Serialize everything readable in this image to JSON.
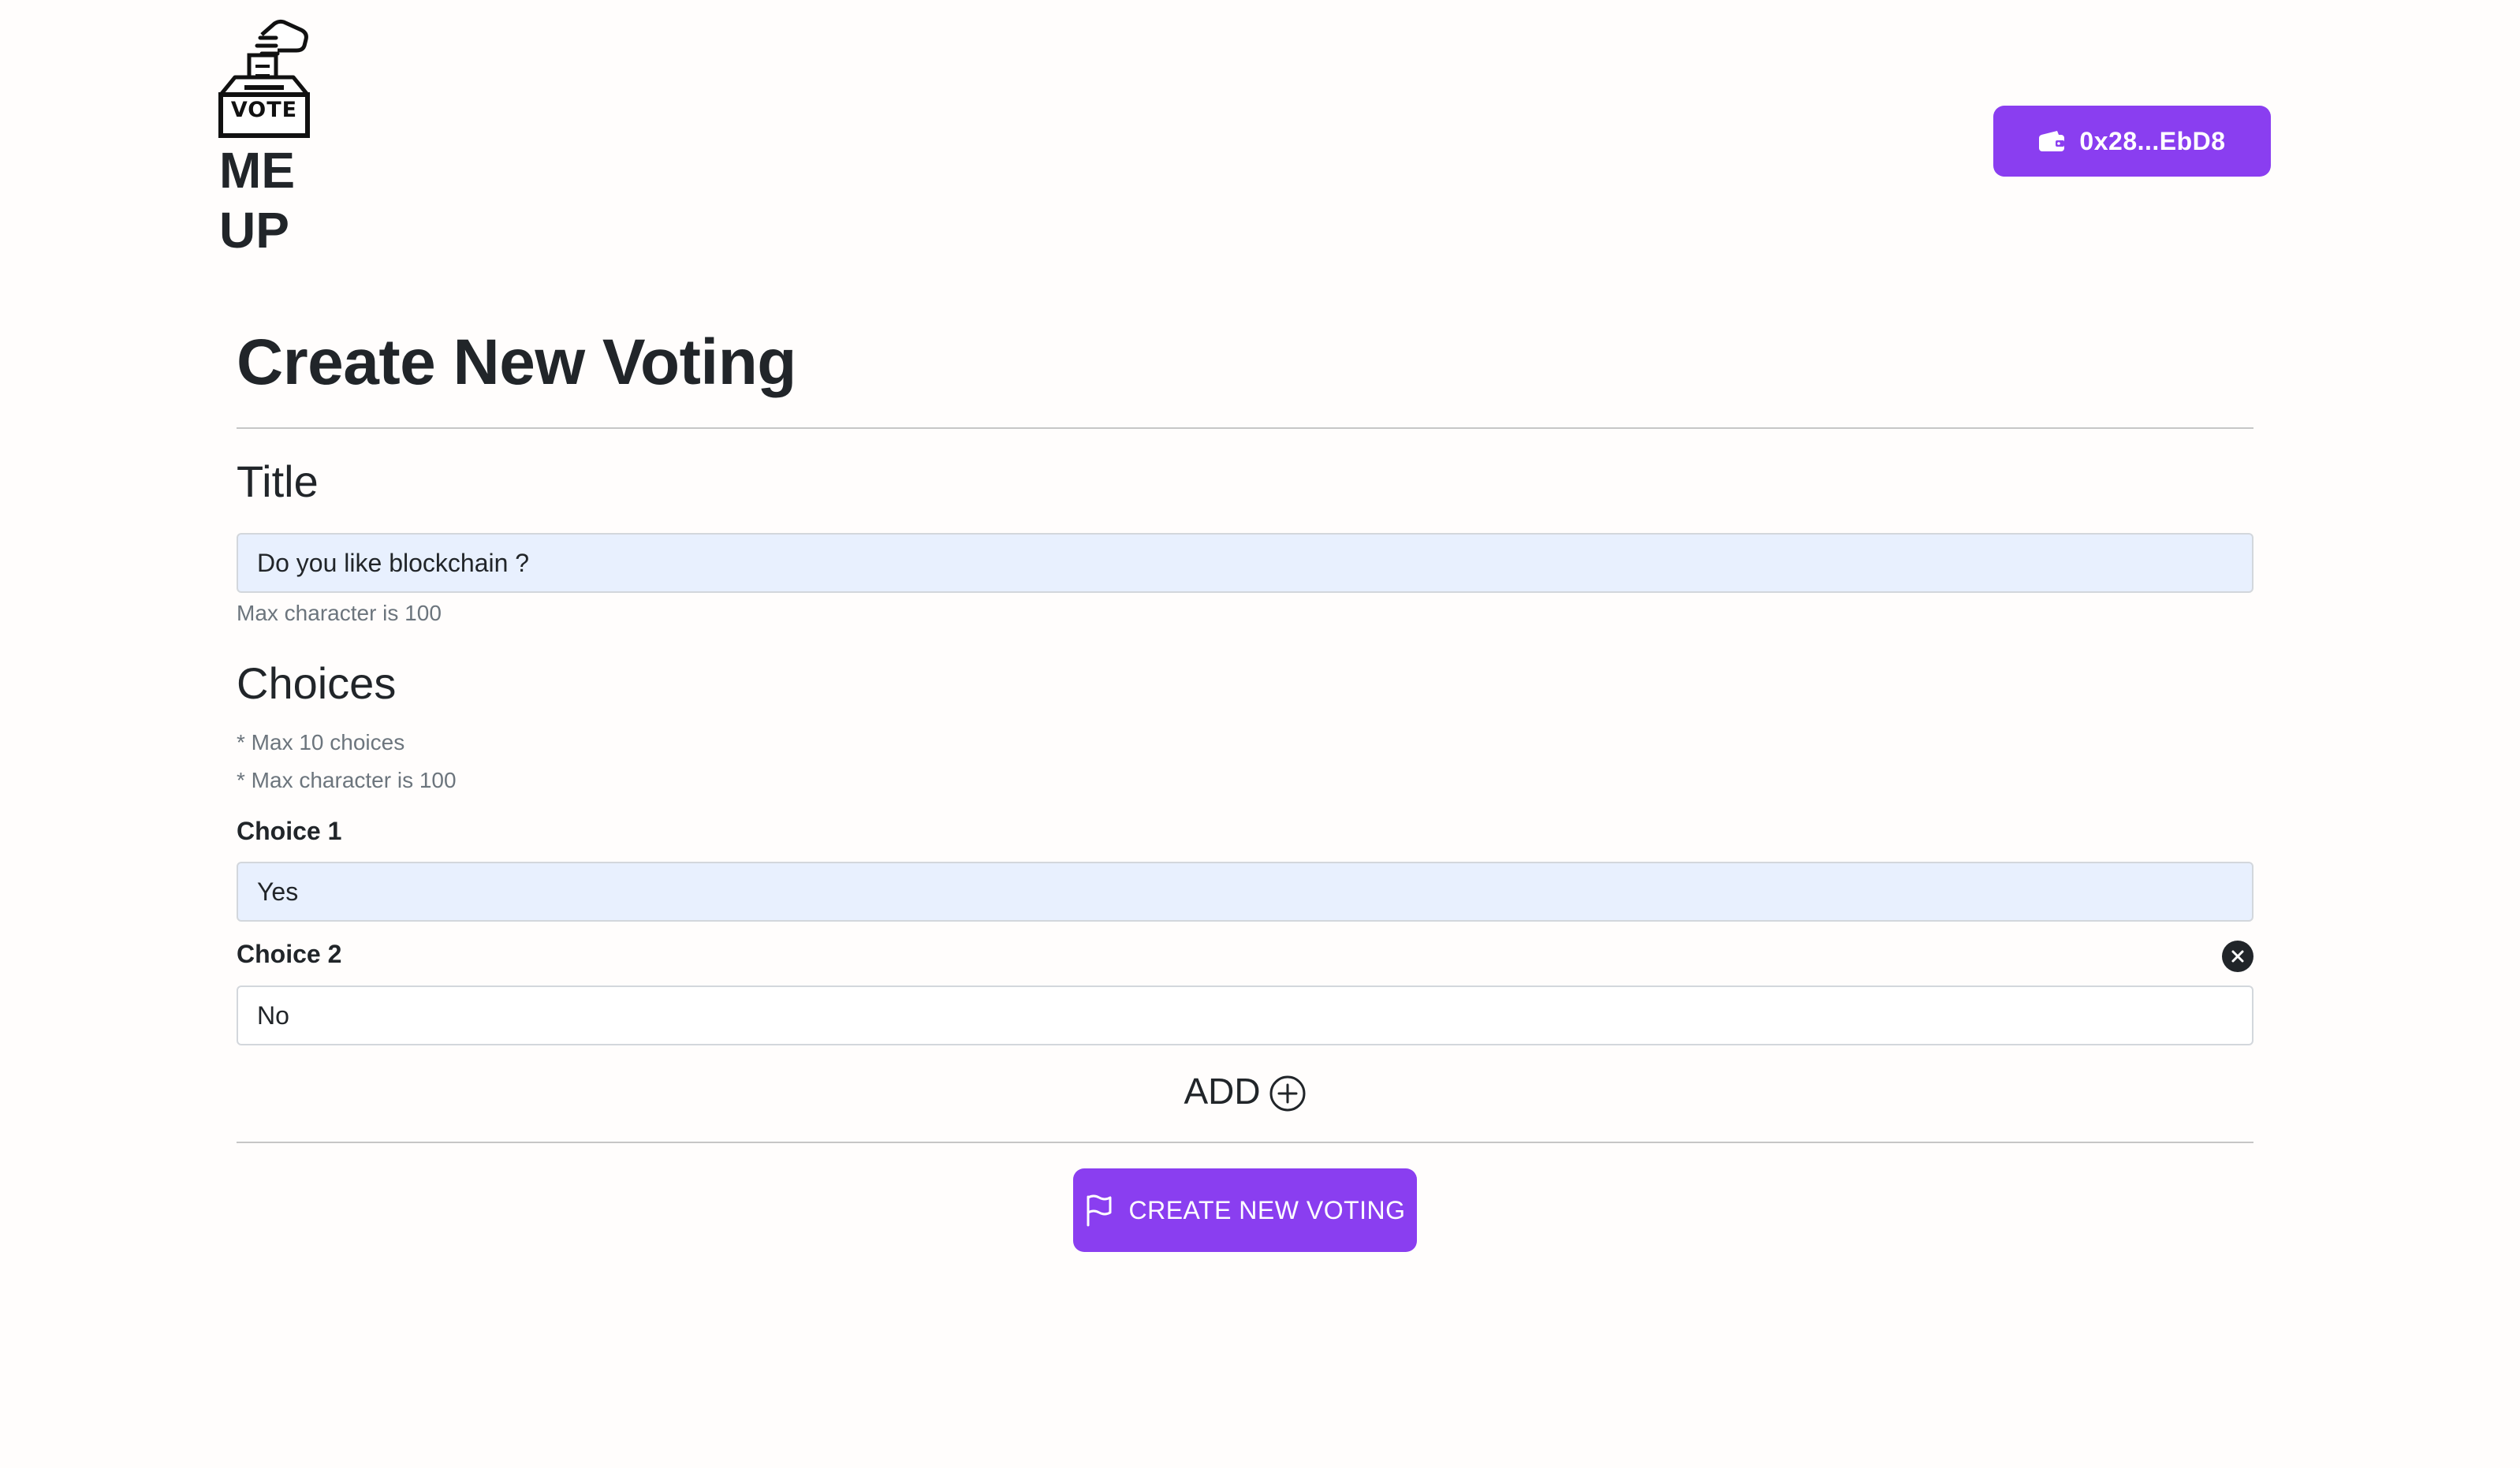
{
  "brand": {
    "logo_label": "VOTE",
    "name_line1": "ME",
    "name_line2": "UP"
  },
  "wallet": {
    "address": "0x28...EbD8",
    "icon": "wallet-icon"
  },
  "page": {
    "title": "Create New Voting"
  },
  "title_section": {
    "heading": "Title",
    "value": "Do you like blockchain ?",
    "help": "Max character is 100"
  },
  "choices_section": {
    "heading": "Choices",
    "notes": [
      "* Max 10 choices",
      "* Max character is 100"
    ],
    "items": [
      {
        "label": "Choice 1",
        "value": "Yes"
      },
      {
        "label": "Choice 2",
        "value": "No"
      }
    ],
    "add_label": "ADD"
  },
  "submit": {
    "label": "CREATE NEW VOTING",
    "icon": "flag-icon"
  },
  "colors": {
    "accent": "#8a3ef0",
    "autofill_bg": "#e8f0fe",
    "text": "#212529",
    "muted": "#6c757d"
  }
}
